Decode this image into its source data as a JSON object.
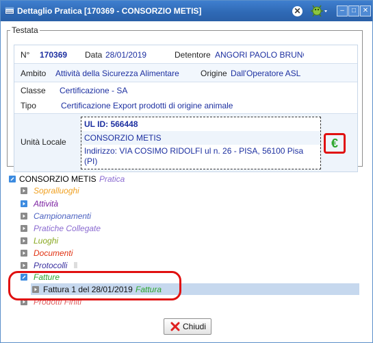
{
  "window": {
    "title": "Dettaglio Pratica [170369 - CONSORZIO METIS]"
  },
  "testata": {
    "legend": "Testata",
    "n_label": "N°",
    "n_value": "170369",
    "data_label": "Data",
    "data_value": "28/01/2019",
    "detentore_label": "Detentore",
    "detentore_value": "ANGORI PAOLO BRUNO",
    "ambito_label": "Ambito",
    "ambito_value": "Attività della Sicurezza Alimentare",
    "origine_label": "Origine",
    "origine_value": "Dall'Operatore ASL",
    "classe_label": "Classe",
    "classe_value": "Certificazione - SA",
    "tipo_label": "Tipo",
    "tipo_value": "Certificazione Export prodotti di origine animale",
    "unita_label": "Unità Locale",
    "ul_id": "UL ID: 566448",
    "ul_name": "CONSORZIO METIS",
    "ul_address": "Indirizzo: VIA COSIMO RIDOLFI ul n. 26 - PISA, 56100 Pisa (PI)",
    "euro_symbol": "€"
  },
  "tree": {
    "root_name": "CONSORZIO METIS",
    "root_type": "Pratica",
    "children": [
      {
        "label": "Sopralluoghi",
        "color": "#f0a020"
      },
      {
        "label": "Attività",
        "color": "#7a1fa0"
      },
      {
        "label": "Campionamenti",
        "color": "#4a60c0"
      },
      {
        "label": "Pratiche Collegate",
        "color": "#8a6ad0"
      },
      {
        "label": "Luoghi",
        "color": "#88a820"
      },
      {
        "label": "Documenti",
        "color": "#e03010"
      },
      {
        "label": "Protocolli",
        "color": "#3a30a0"
      },
      {
        "label": "Fatture",
        "color": "#2aa52a"
      },
      {
        "label": "Prodotti Finiti",
        "color": "#e06060"
      }
    ],
    "fattura_item": "Fattura 1 del 28/01/2019",
    "fattura_type": "Fattura"
  },
  "buttons": {
    "chiudi": "Chiudi"
  }
}
